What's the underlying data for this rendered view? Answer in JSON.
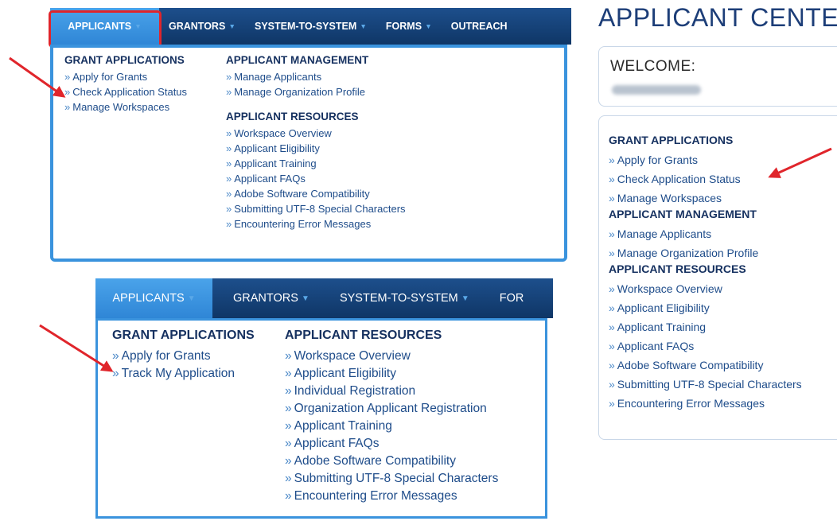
{
  "menu1": {
    "nav": [
      {
        "label": "APPLICANTS",
        "caret": "▼"
      },
      {
        "label": "GRANTORS",
        "caret": "▼"
      },
      {
        "label": "SYSTEM-TO-SYSTEM",
        "caret": "▼"
      },
      {
        "label": "FORMS",
        "caret": "▼"
      },
      {
        "label": "OUTREACH",
        "caret": ""
      }
    ],
    "grant_applications": {
      "heading": "GRANT APPLICATIONS",
      "links": [
        "Apply for Grants",
        "Check Application Status",
        "Manage Workspaces"
      ]
    },
    "applicant_management": {
      "heading": "APPLICANT MANAGEMENT",
      "links": [
        "Manage Applicants",
        "Manage Organization Profile"
      ]
    },
    "applicant_resources": {
      "heading": "APPLICANT RESOURCES",
      "links": [
        "Workspace Overview",
        "Applicant Eligibility",
        "Applicant Training",
        "Applicant FAQs",
        "Adobe Software Compatibility",
        "Submitting UTF-8 Special Characters",
        "Encountering Error Messages"
      ]
    }
  },
  "menu2": {
    "nav": [
      {
        "label": "APPLICANTS",
        "caret": "▼"
      },
      {
        "label": "GRANTORS",
        "caret": "▼"
      },
      {
        "label": "SYSTEM-TO-SYSTEM",
        "caret": "▼"
      },
      {
        "label": "FOR",
        "caret": ""
      }
    ],
    "grant_applications": {
      "heading": "GRANT APPLICATIONS",
      "links": [
        "Apply for Grants",
        "Track My Application"
      ]
    },
    "applicant_resources": {
      "heading": "APPLICANT RESOURCES",
      "links": [
        "Workspace Overview",
        "Applicant Eligibility",
        "Individual Registration",
        "Organization Applicant Registration",
        "Applicant Training",
        "Applicant FAQs",
        "Adobe Software Compatibility",
        "Submitting UTF-8 Special Characters",
        "Encountering Error Messages"
      ]
    }
  },
  "center": {
    "title": "APPLICANT CENTER",
    "welcome_label": "WELCOME:",
    "grant_applications": {
      "heading": "GRANT APPLICATIONS",
      "links": [
        "Apply for Grants",
        "Check Application Status",
        "Manage Workspaces"
      ]
    },
    "applicant_management": {
      "heading": "APPLICANT MANAGEMENT",
      "links": [
        "Manage Applicants",
        "Manage Organization Profile"
      ]
    },
    "applicant_resources": {
      "heading": "APPLICANT RESOURCES",
      "links": [
        "Workspace Overview",
        "Applicant Eligibility",
        "Applicant Training",
        "Applicant FAQs",
        "Adobe Software Compatibility",
        "Submitting UTF-8 Special Characters",
        "Encountering Error Messages"
      ]
    }
  },
  "bullet": "»",
  "colors": {
    "nav_bg": "#0f3666",
    "nav_active": "#3a93dd",
    "highlight": "#e0252b",
    "arrow": "#e0252b",
    "heading": "#163160",
    "link": "#1e4c8a"
  }
}
